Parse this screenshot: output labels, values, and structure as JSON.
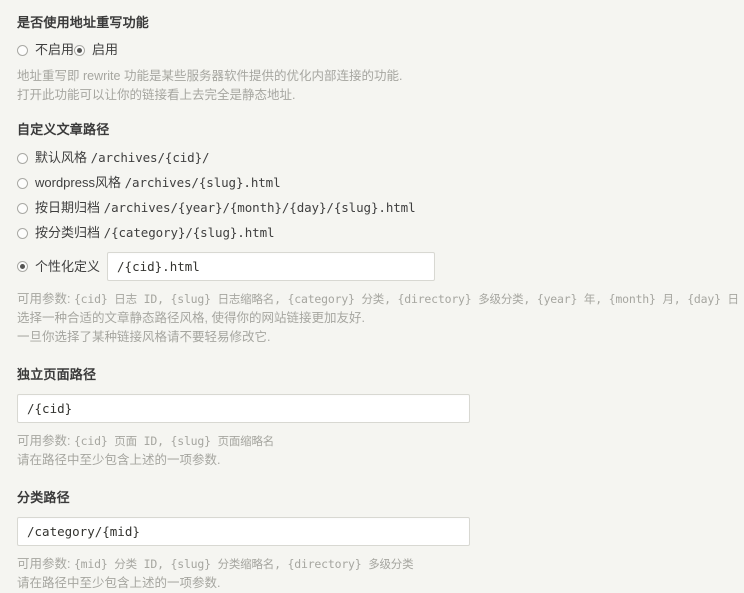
{
  "rewrite_section": {
    "title": "是否使用地址重写功能",
    "options": [
      {
        "label": "不启用",
        "checked": false
      },
      {
        "label": "启用",
        "checked": true
      }
    ],
    "desc_line1": "地址重写即 rewrite 功能是某些服务器软件提供的优化内部连接的功能.",
    "desc_line2": "打开此功能可以让你的链接看上去完全是静态地址."
  },
  "post_path_section": {
    "title": "自定义文章路径",
    "options": [
      {
        "name": "默认风格",
        "pattern": "/archives/{cid}/",
        "checked": false
      },
      {
        "name": "wordpress风格",
        "pattern": "/archives/{slug}.html",
        "checked": false
      },
      {
        "name": "按日期归档",
        "pattern": "/archives/{year}/{month}/{day}/{slug}.html",
        "checked": false
      },
      {
        "name": "按分类归档",
        "pattern": "/{category}/{slug}.html",
        "checked": false
      }
    ],
    "custom": {
      "label": "个性化定义",
      "checked": true,
      "value": "/{cid}.html",
      "placeholder": ""
    },
    "help_params_prefix": "可用参数: ",
    "help_params": "{cid} 日志 ID, {slug} 日志缩略名, {category} 分类, {directory} 多级分类, {year} 年, {month} 月, {day} 日",
    "help_line2": "选择一种合适的文章静态路径风格, 使得你的网站链接更加友好.",
    "help_line3": "一旦你选择了某种链接风格请不要轻易修改它."
  },
  "page_path_section": {
    "title": "独立页面路径",
    "value": "/{cid}",
    "placeholder": "",
    "help_params_prefix": "可用参数: ",
    "help_params": "{cid} 页面 ID, {slug} 页面缩略名",
    "help_line2": "请在路径中至少包含上述的一项参数."
  },
  "category_path_section": {
    "title": "分类路径",
    "value": "/category/{mid}",
    "placeholder": "",
    "help_params_prefix": "可用参数: ",
    "help_params": "{mid} 分类 ID, {slug} 分类缩略名, {directory} 多级分类",
    "help_line2": "请在路径中至少包含上述的一项参数."
  },
  "colors": {
    "background": "#f5f5f1",
    "input_background": "#ffffff",
    "input_border": "#d8d8d2",
    "heading_text": "#3a3a3a",
    "body_text": "#3f3f3f",
    "muted_text": "#a6a6a0",
    "radio_border": "#a9a9a4",
    "radio_dot": "#555553"
  }
}
